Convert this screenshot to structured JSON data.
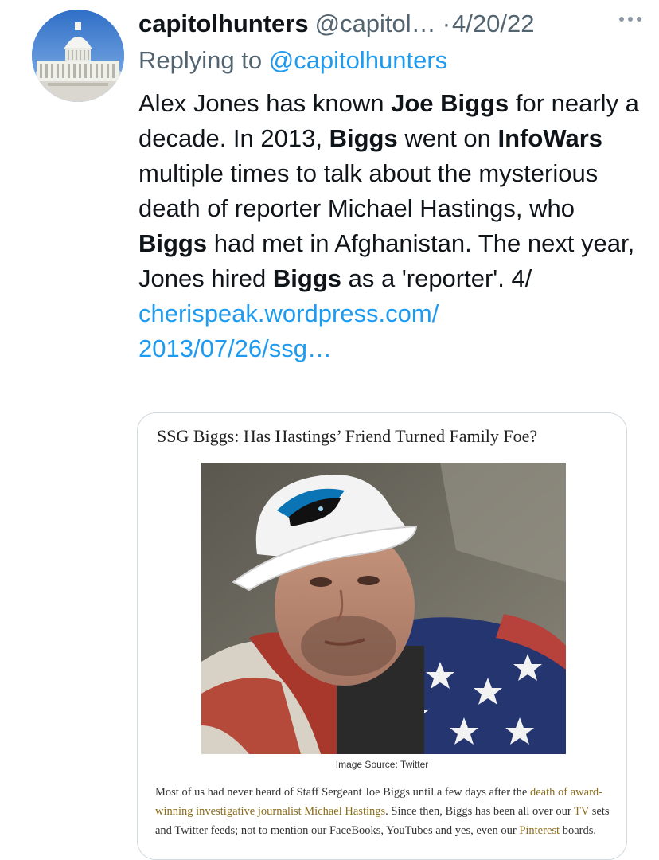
{
  "tweet": {
    "display_name": "capitolhunters",
    "handle": "@capitol…",
    "date_separator": "·",
    "date": "4/20/22",
    "more_icon": "more-horizontal-icon",
    "replying_prefix": "Replying to",
    "replying_mention": "@capitolhunters",
    "text": {
      "s1": "Alex Jones has known ",
      "b1": "Joe Biggs",
      "s2": " for nearly a decade. In 2013, ",
      "b2": "Biggs",
      "s3": " went on ",
      "b3": "InfoWars",
      "s4": " multiple times to talk about the mysterious death of reporter Michael Hastings, who ",
      "b4": "Biggs",
      "s5": " had met in Afghanistan. The next year, Jones hired ",
      "b5": "Biggs",
      "s6": " as a 'reporter'. 4/"
    },
    "link_line1": "cherispeak.wordpress.com/",
    "link_line2": "2013/07/26/ssg…"
  },
  "card": {
    "title": "SSG Biggs: Has Hastings’ Friend Turned Family Foe?",
    "image_caption": "Image Source: Twitter",
    "excerpt": {
      "p1": "Most of us had never heard of Staff Sergeant Joe Biggs until a few days after the ",
      "l1": "death of award-winning investigative journalist Michael Hastings",
      "p2": ". Since then, Biggs has been all over our ",
      "l2": "TV",
      "p3": " sets and Twitter feeds; not to mention our FaceBooks, YouTubes and yes, even our ",
      "l3": "Pinterest",
      "p4": " boards."
    }
  },
  "colors": {
    "link": "#1d9bf0",
    "secondary_text": "#536471",
    "card_border": "#cfd9de",
    "excerpt_link": "#8a6d1f"
  }
}
